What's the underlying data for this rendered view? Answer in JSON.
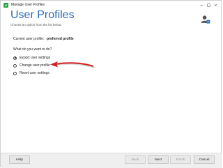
{
  "window": {
    "title": "Manage User Profiles",
    "controls": [
      "minimize-icon",
      "maximize-icon",
      "close-icon"
    ]
  },
  "header": {
    "title": "User Profiles",
    "subtitle": "Choose an option from the list below.",
    "icon": "user-settings-icon"
  },
  "current_profile": {
    "label": "Current user profile:",
    "value": "preferred profile"
  },
  "question": "What do you want to do?",
  "options": [
    {
      "label": "Export user settings",
      "selected": true
    },
    {
      "label": "Change user profile",
      "selected": false
    },
    {
      "label": "Reset user settings",
      "selected": false
    }
  ],
  "annotation": {
    "icon": "red-arrow-icon",
    "color": "#d42020"
  },
  "footer": {
    "help": "Help",
    "back": "Back",
    "next": "Next",
    "finish": "Finish",
    "cancel": "Cancel"
  },
  "colors": {
    "accent": "#2b6cb6",
    "app_icon": "#2ba84a"
  }
}
